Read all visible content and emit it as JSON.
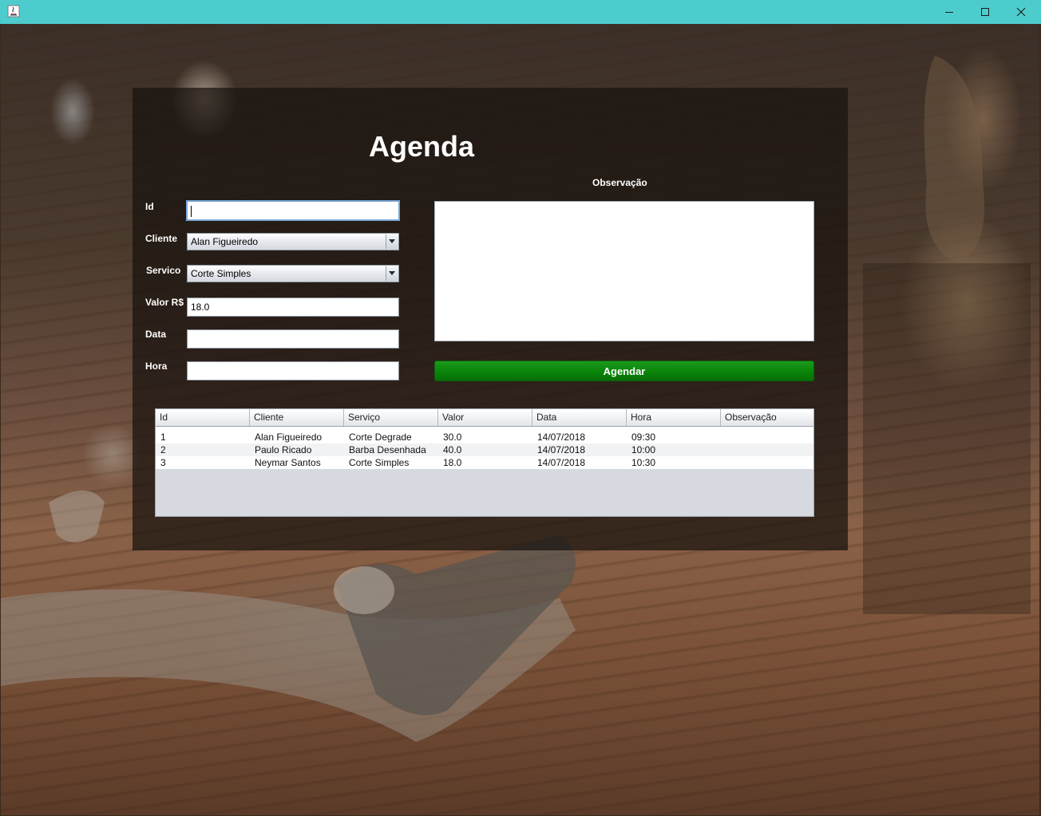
{
  "window": {
    "title_bar_color": "#4dcccd",
    "controls": {
      "minimize": "minimize-icon",
      "maximize": "maximize-icon",
      "close": "close-icon"
    }
  },
  "form": {
    "title": "Agenda",
    "id": {
      "label": "Id",
      "value": ""
    },
    "cliente": {
      "label": "Cliente",
      "selected": "Alan Figueiredo"
    },
    "servico": {
      "label": "Servico",
      "selected": "Corte Simples"
    },
    "valor": {
      "label": "Valor R$",
      "value": "18.0"
    },
    "data": {
      "label": "Data",
      "value": ""
    },
    "hora": {
      "label": "Hora",
      "value": ""
    },
    "observacao": {
      "label": "Observação",
      "value": ""
    },
    "submit_label": "Agendar",
    "submit_color": "#098409"
  },
  "table": {
    "headers": [
      "Id",
      "Cliente",
      "Serviço",
      "Valor",
      "Data",
      "Hora",
      "Observação"
    ],
    "rows": [
      [
        "1",
        "Alan Figueiredo",
        "Corte Degrade",
        "30.0",
        "14/07/2018",
        "09:30",
        ""
      ],
      [
        "2",
        "Paulo Ricado",
        "Barba Desenhada",
        "40.0",
        "14/07/2018",
        "10:00",
        ""
      ],
      [
        "3",
        "Neymar Santos",
        "Corte Simples",
        "18.0",
        "14/07/2018",
        "10:30",
        ""
      ]
    ]
  }
}
